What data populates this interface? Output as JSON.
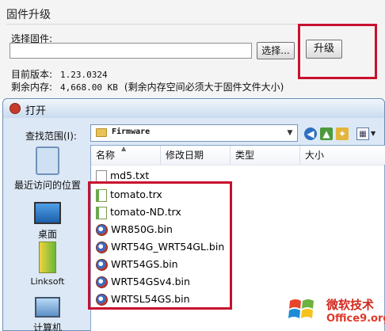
{
  "firmware_panel": {
    "title": "固件升级",
    "choose_label": "选择固件:",
    "path_value": "",
    "browse_label": "选择...",
    "upgrade_label": "升级",
    "version_label": "目前版本:",
    "version_value": "1.23.0324",
    "memory_label": "剩余内存:",
    "memory_value": "4,668.00 KB",
    "memory_note": "(剩余内存空间必须大于固件文件大小)"
  },
  "open_dialog": {
    "title": "打开",
    "look_in_label": "查找范围(I):",
    "look_in_value": "Firmware",
    "places": [
      {
        "label": "最近访问的位置",
        "icon": "recent-places-icon"
      },
      {
        "label": "桌面",
        "icon": "desktop-icon"
      },
      {
        "label": "Linksoft",
        "icon": "documents-icon"
      },
      {
        "label": "计算机",
        "icon": "computer-icon"
      }
    ],
    "columns": [
      "名称",
      "修改日期",
      "类型",
      "大小"
    ],
    "files": [
      {
        "name": "md5.txt",
        "icon": "text-file-icon"
      },
      {
        "name": "tomato.trx",
        "icon": "trx-file-icon"
      },
      {
        "name": "tomato-ND.trx",
        "icon": "trx-file-icon"
      },
      {
        "name": "WR850G.bin",
        "icon": "bin-file-icon"
      },
      {
        "name": "WRT54G_WRT54GL.bin",
        "icon": "bin-file-icon"
      },
      {
        "name": "WRT54GS.bin",
        "icon": "bin-file-icon"
      },
      {
        "name": "WRT54GSv4.bin",
        "icon": "bin-file-icon"
      },
      {
        "name": "WRTSL54GS.bin",
        "icon": "bin-file-icon"
      }
    ]
  },
  "watermark": {
    "text": "微软技术",
    "url": "Office9.org"
  },
  "colors": {
    "highlight": "#c8102e",
    "dialog_bg": "#dce8f5"
  }
}
